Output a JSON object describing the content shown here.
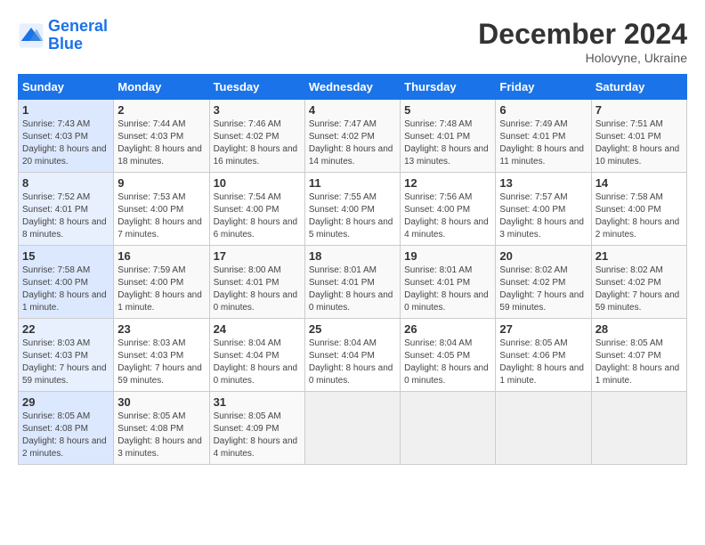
{
  "header": {
    "logo_line1": "General",
    "logo_line2": "Blue",
    "month": "December 2024",
    "location": "Holovyne, Ukraine"
  },
  "weekdays": [
    "Sunday",
    "Monday",
    "Tuesday",
    "Wednesday",
    "Thursday",
    "Friday",
    "Saturday"
  ],
  "weeks": [
    [
      {
        "day": "1",
        "sunrise": "7:43 AM",
        "sunset": "4:03 PM",
        "daylight": "8 hours and 20 minutes."
      },
      {
        "day": "2",
        "sunrise": "7:44 AM",
        "sunset": "4:03 PM",
        "daylight": "8 hours and 18 minutes."
      },
      {
        "day": "3",
        "sunrise": "7:46 AM",
        "sunset": "4:02 PM",
        "daylight": "8 hours and 16 minutes."
      },
      {
        "day": "4",
        "sunrise": "7:47 AM",
        "sunset": "4:02 PM",
        "daylight": "8 hours and 14 minutes."
      },
      {
        "day": "5",
        "sunrise": "7:48 AM",
        "sunset": "4:01 PM",
        "daylight": "8 hours and 13 minutes."
      },
      {
        "day": "6",
        "sunrise": "7:49 AM",
        "sunset": "4:01 PM",
        "daylight": "8 hours and 11 minutes."
      },
      {
        "day": "7",
        "sunrise": "7:51 AM",
        "sunset": "4:01 PM",
        "daylight": "8 hours and 10 minutes."
      }
    ],
    [
      {
        "day": "8",
        "sunrise": "7:52 AM",
        "sunset": "4:01 PM",
        "daylight": "8 hours and 8 minutes."
      },
      {
        "day": "9",
        "sunrise": "7:53 AM",
        "sunset": "4:00 PM",
        "daylight": "8 hours and 7 minutes."
      },
      {
        "day": "10",
        "sunrise": "7:54 AM",
        "sunset": "4:00 PM",
        "daylight": "8 hours and 6 minutes."
      },
      {
        "day": "11",
        "sunrise": "7:55 AM",
        "sunset": "4:00 PM",
        "daylight": "8 hours and 5 minutes."
      },
      {
        "day": "12",
        "sunrise": "7:56 AM",
        "sunset": "4:00 PM",
        "daylight": "8 hours and 4 minutes."
      },
      {
        "day": "13",
        "sunrise": "7:57 AM",
        "sunset": "4:00 PM",
        "daylight": "8 hours and 3 minutes."
      },
      {
        "day": "14",
        "sunrise": "7:58 AM",
        "sunset": "4:00 PM",
        "daylight": "8 hours and 2 minutes."
      }
    ],
    [
      {
        "day": "15",
        "sunrise": "7:58 AM",
        "sunset": "4:00 PM",
        "daylight": "8 hours and 1 minute."
      },
      {
        "day": "16",
        "sunrise": "7:59 AM",
        "sunset": "4:00 PM",
        "daylight": "8 hours and 1 minute."
      },
      {
        "day": "17",
        "sunrise": "8:00 AM",
        "sunset": "4:01 PM",
        "daylight": "8 hours and 0 minutes."
      },
      {
        "day": "18",
        "sunrise": "8:01 AM",
        "sunset": "4:01 PM",
        "daylight": "8 hours and 0 minutes."
      },
      {
        "day": "19",
        "sunrise": "8:01 AM",
        "sunset": "4:01 PM",
        "daylight": "8 hours and 0 minutes."
      },
      {
        "day": "20",
        "sunrise": "8:02 AM",
        "sunset": "4:02 PM",
        "daylight": "7 hours and 59 minutes."
      },
      {
        "day": "21",
        "sunrise": "8:02 AM",
        "sunset": "4:02 PM",
        "daylight": "7 hours and 59 minutes."
      }
    ],
    [
      {
        "day": "22",
        "sunrise": "8:03 AM",
        "sunset": "4:03 PM",
        "daylight": "7 hours and 59 minutes."
      },
      {
        "day": "23",
        "sunrise": "8:03 AM",
        "sunset": "4:03 PM",
        "daylight": "7 hours and 59 minutes."
      },
      {
        "day": "24",
        "sunrise": "8:04 AM",
        "sunset": "4:04 PM",
        "daylight": "8 hours and 0 minutes."
      },
      {
        "day": "25",
        "sunrise": "8:04 AM",
        "sunset": "4:04 PM",
        "daylight": "8 hours and 0 minutes."
      },
      {
        "day": "26",
        "sunrise": "8:04 AM",
        "sunset": "4:05 PM",
        "daylight": "8 hours and 0 minutes."
      },
      {
        "day": "27",
        "sunrise": "8:05 AM",
        "sunset": "4:06 PM",
        "daylight": "8 hours and 1 minute."
      },
      {
        "day": "28",
        "sunrise": "8:05 AM",
        "sunset": "4:07 PM",
        "daylight": "8 hours and 1 minute."
      }
    ],
    [
      {
        "day": "29",
        "sunrise": "8:05 AM",
        "sunset": "4:08 PM",
        "daylight": "8 hours and 2 minutes."
      },
      {
        "day": "30",
        "sunrise": "8:05 AM",
        "sunset": "4:08 PM",
        "daylight": "8 hours and 3 minutes."
      },
      {
        "day": "31",
        "sunrise": "8:05 AM",
        "sunset": "4:09 PM",
        "daylight": "8 hours and 4 minutes."
      },
      null,
      null,
      null,
      null
    ]
  ]
}
